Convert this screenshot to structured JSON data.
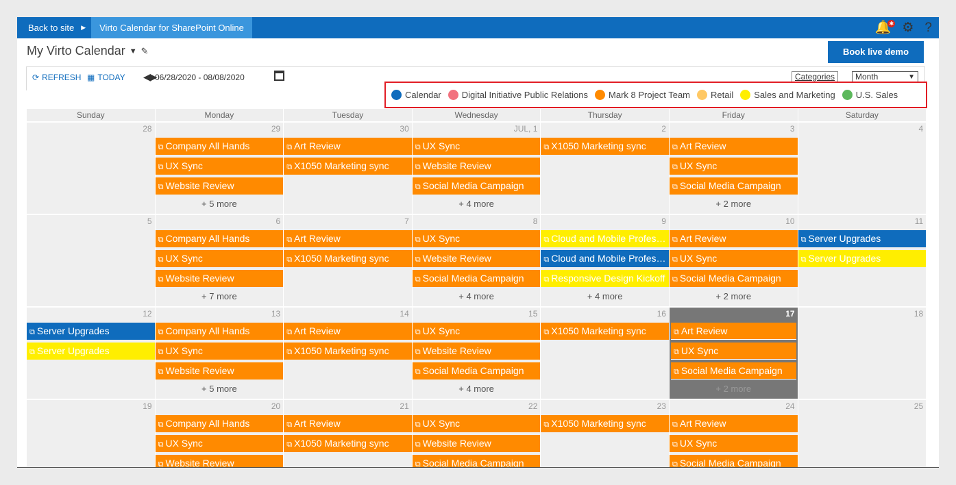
{
  "topbar": {
    "back_label": "Back to site",
    "app_label": "Virto Calendar for SharePoint Online",
    "bell_badge": "✱"
  },
  "header": {
    "title": "My Virto Calendar",
    "demo_button": "Book live demo"
  },
  "toolbar": {
    "refresh": "REFRESH",
    "today": "TODAY",
    "date_range": "06/28/2020 - 08/08/2020",
    "categories": "Categories",
    "view": "Month"
  },
  "legend": [
    {
      "label": "Calendar",
      "color": "#0f6cbd"
    },
    {
      "label": "Digital Initiative Public Relations",
      "color": "#f2727f"
    },
    {
      "label": "Mark 8 Project Team",
      "color": "#ff8a00"
    },
    {
      "label": "Retail",
      "color": "#ffc864"
    },
    {
      "label": "Sales and Marketing",
      "color": "#ffee00"
    },
    {
      "label": "U.S. Sales",
      "color": "#5cb85c"
    }
  ],
  "weekdays": [
    "Sunday",
    "Monday",
    "Tuesday",
    "Wednesday",
    "Thursday",
    "Friday",
    "Saturday"
  ],
  "weeks": [
    [
      {
        "num": "28",
        "events": [],
        "more": ""
      },
      {
        "num": "29",
        "events": [
          [
            "Company All Hands",
            "orange"
          ],
          [
            "UX Sync",
            "orange"
          ],
          [
            "Website Review",
            "orange"
          ]
        ],
        "more": "+ 5 more"
      },
      {
        "num": "30",
        "events": [
          [
            "Art Review",
            "orange"
          ],
          [
            "X1050 Marketing sync",
            "orange"
          ]
        ],
        "more": ""
      },
      {
        "num": "JUL, 1",
        "events": [
          [
            "UX Sync",
            "orange"
          ],
          [
            "Website Review",
            "orange"
          ],
          [
            "Social Media Campaign",
            "orange"
          ]
        ],
        "more": "+ 4 more"
      },
      {
        "num": "2",
        "events": [
          [
            "X1050 Marketing sync",
            "orange"
          ]
        ],
        "more": ""
      },
      {
        "num": "3",
        "events": [
          [
            "Art Review",
            "orange"
          ],
          [
            "UX Sync",
            "orange"
          ],
          [
            "Social Media Campaign",
            "orange"
          ]
        ],
        "more": "+ 2 more"
      },
      {
        "num": "4",
        "events": [],
        "more": ""
      }
    ],
    [
      {
        "num": "5",
        "events": [],
        "more": ""
      },
      {
        "num": "6",
        "events": [
          [
            "Company All Hands",
            "orange"
          ],
          [
            "UX Sync",
            "orange"
          ],
          [
            "Website Review",
            "orange"
          ]
        ],
        "more": "+ 7 more"
      },
      {
        "num": "7",
        "events": [
          [
            "Art Review",
            "orange"
          ],
          [
            "X1050 Marketing sync",
            "orange"
          ]
        ],
        "more": ""
      },
      {
        "num": "8",
        "events": [
          [
            "UX Sync",
            "orange"
          ],
          [
            "Website Review",
            "orange"
          ],
          [
            "Social Media Campaign",
            "orange"
          ]
        ],
        "more": "+ 4 more"
      },
      {
        "num": "9",
        "events": [
          [
            "Cloud and Mobile Professionals",
            "yellow"
          ],
          [
            "Cloud and Mobile Professionals",
            "blue"
          ],
          [
            "Responsive Design Kickoff",
            "yellow"
          ]
        ],
        "more": "+ 4 more"
      },
      {
        "num": "10",
        "events": [
          [
            "Art Review",
            "orange"
          ],
          [
            "UX Sync",
            "orange"
          ],
          [
            "Social Media Campaign",
            "orange"
          ]
        ],
        "more": "+ 2 more"
      },
      {
        "num": "11",
        "events": [
          [
            "Server Upgrades",
            "blue"
          ],
          [
            "Server Upgrades",
            "yellow"
          ]
        ],
        "more": ""
      }
    ],
    [
      {
        "num": "12",
        "events": [
          [
            "Server Upgrades",
            "blue"
          ],
          [
            "Server Upgrades",
            "yellow"
          ]
        ],
        "more": ""
      },
      {
        "num": "13",
        "events": [
          [
            "Company All Hands",
            "orange"
          ],
          [
            "UX Sync",
            "orange"
          ],
          [
            "Website Review",
            "orange"
          ]
        ],
        "more": "+ 5 more"
      },
      {
        "num": "14",
        "events": [
          [
            "Art Review",
            "orange"
          ],
          [
            "X1050 Marketing sync",
            "orange"
          ]
        ],
        "more": ""
      },
      {
        "num": "15",
        "events": [
          [
            "UX Sync",
            "orange"
          ],
          [
            "Website Review",
            "orange"
          ],
          [
            "Social Media Campaign",
            "orange"
          ]
        ],
        "more": "+ 4 more"
      },
      {
        "num": "16",
        "events": [
          [
            "X1050 Marketing sync",
            "orange"
          ]
        ],
        "more": ""
      },
      {
        "num": "17",
        "today": true,
        "events": [
          [
            "Art Review",
            "orange"
          ],
          [
            "UX Sync",
            "orange"
          ],
          [
            "Social Media Campaign",
            "orange"
          ]
        ],
        "more": "+ 2 more"
      },
      {
        "num": "18",
        "events": [],
        "more": ""
      }
    ],
    [
      {
        "num": "19",
        "events": [],
        "more": ""
      },
      {
        "num": "20",
        "events": [
          [
            "Company All Hands",
            "orange"
          ],
          [
            "UX Sync",
            "orange"
          ],
          [
            "Website Review",
            "orange"
          ]
        ],
        "more": ""
      },
      {
        "num": "21",
        "events": [
          [
            "Art Review",
            "orange"
          ],
          [
            "X1050 Marketing sync",
            "orange"
          ]
        ],
        "more": ""
      },
      {
        "num": "22",
        "events": [
          [
            "UX Sync",
            "orange"
          ],
          [
            "Website Review",
            "orange"
          ],
          [
            "Social Media Campaign",
            "orange"
          ]
        ],
        "more": ""
      },
      {
        "num": "23",
        "events": [
          [
            "X1050 Marketing sync",
            "orange"
          ]
        ],
        "more": ""
      },
      {
        "num": "24",
        "events": [
          [
            "Art Review",
            "orange"
          ],
          [
            "UX Sync",
            "orange"
          ],
          [
            "Social Media Campaign",
            "orange"
          ]
        ],
        "more": ""
      },
      {
        "num": "25",
        "events": [],
        "more": ""
      }
    ]
  ]
}
